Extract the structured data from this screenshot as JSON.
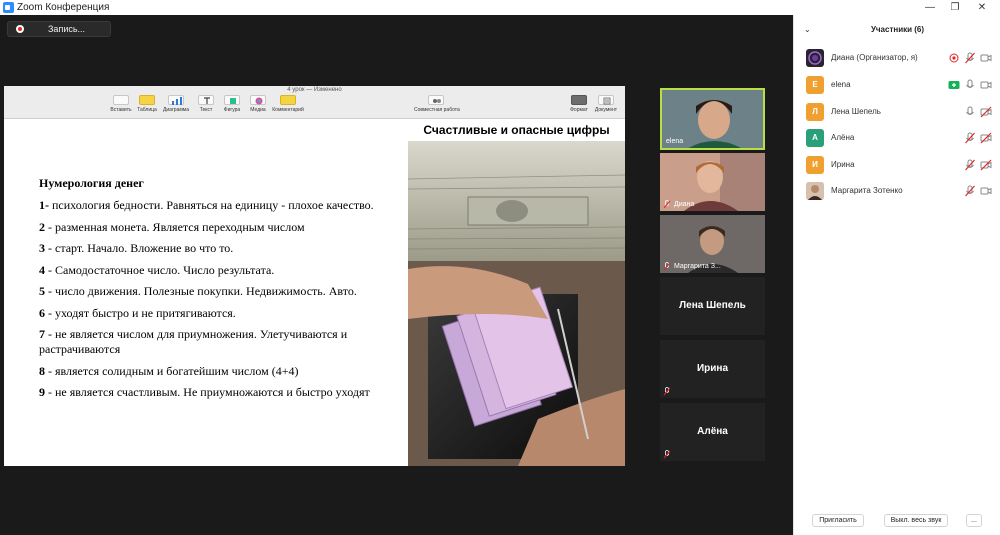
{
  "window": {
    "title": "Zoom Конференция",
    "minimize": "—",
    "maximize": "❐",
    "close": "✕"
  },
  "recording": {
    "label": "Запись..."
  },
  "keynote": {
    "doc_title": "4 урок — Изменено",
    "toolbar": [
      "Вставить",
      "Таблица",
      "Диаграмма",
      "Текст",
      "Фигура",
      "Медиа",
      "Комментарий"
    ],
    "collab": "Совместная работа",
    "format": "Формат",
    "document": "Документ"
  },
  "slide": {
    "heading": "Нумерология денег",
    "items": [
      {
        "num": "1-",
        "text": " психология бедности. Равняться на единицу - плохое качество."
      },
      {
        "num": "2",
        "text": " - разменная монета. Является переходным числом"
      },
      {
        "num": "3",
        "text": " - старт. Начало. Вложение во что то."
      },
      {
        "num": "4",
        "text": " - Самодостаточное число. Число результата."
      },
      {
        "num": "5",
        "text": " - число движения. Полезные покупки. Недвижимость. Авто."
      },
      {
        "num": "6",
        "text": " - уходят быстро и не притягиваются."
      },
      {
        "num": "7",
        "text": " - не является числом для приумножения. Улетучиваются и растрачиваются"
      },
      {
        "num": "8",
        "text": " - является  солидным и богатейшим числом (4+4)"
      },
      {
        "num": "9",
        "text": " - не является счастливым. Не приумножаются и быстро уходят"
      }
    ],
    "image_title": "Счастливые и опасные цифры"
  },
  "thumbnails": [
    {
      "name": "elena",
      "type": "video",
      "active": true,
      "muted": false
    },
    {
      "name": "Диана",
      "type": "video",
      "active": false,
      "muted": true
    },
    {
      "name": "Маргарита З...",
      "type": "video",
      "active": false,
      "muted": true
    },
    {
      "name": "Лена Шепель",
      "type": "tile",
      "active": false,
      "muted": false
    },
    {
      "name": "Ирина",
      "type": "tile",
      "active": false,
      "muted": true
    },
    {
      "name": "Алёна",
      "type": "tile",
      "active": false,
      "muted": true
    }
  ],
  "participants": {
    "title": "Участники (6)",
    "list": [
      {
        "initial": "",
        "name": "Диана (Организатор, я)",
        "avatar_color": "#3a2e4a",
        "mic": "muted",
        "video": "on"
      },
      {
        "initial": "E",
        "name": "elena",
        "avatar_color": "#f0a030",
        "mic": "on",
        "video": "on"
      },
      {
        "initial": "Л",
        "name": "Лена Шепель",
        "avatar_color": "#f0a030",
        "mic": "on",
        "video": "off"
      },
      {
        "initial": "А",
        "name": "Алёна",
        "avatar_color": "#2aa07a",
        "mic": "muted",
        "video": "off"
      },
      {
        "initial": "И",
        "name": "Ирина",
        "avatar_color": "#f0a030",
        "mic": "muted",
        "video": "off"
      },
      {
        "initial": "",
        "name": "Маргарита Зотенко",
        "avatar_color": "#c9a68a",
        "mic": "muted",
        "video": "on"
      }
    ],
    "invite": "Пригласить",
    "mute_all": "Выкл. весь звук",
    "more": "..."
  }
}
